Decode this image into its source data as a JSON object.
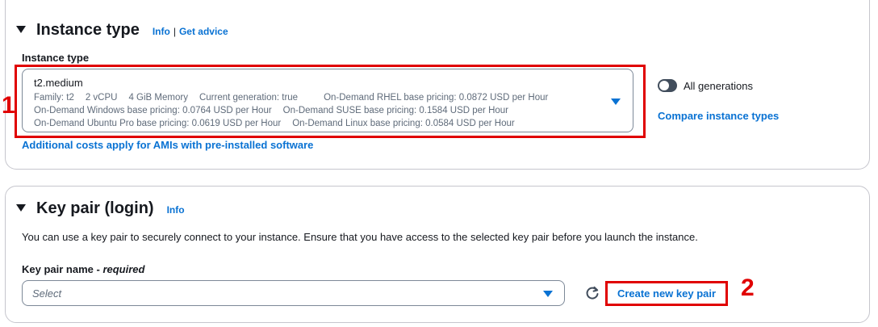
{
  "instance_section": {
    "title": "Instance type",
    "info_label": "Info",
    "separator": "|",
    "advice_label": "Get advice",
    "field_label": "Instance type",
    "selected": {
      "name": "t2.medium",
      "line1": [
        "Family: t2",
        "2 vCPU",
        "4 GiB Memory",
        "Current generation: true",
        "On-Demand RHEL base pricing: 0.0872 USD per Hour"
      ],
      "line2": [
        "On-Demand Windows base pricing: 0.0764 USD per Hour",
        "On-Demand SUSE base pricing: 0.1584 USD per Hour"
      ],
      "line3": [
        "On-Demand Ubuntu Pro base pricing: 0.0619 USD per Hour",
        "On-Demand Linux base pricing: 0.0584 USD per Hour"
      ]
    },
    "toggle_label": "All generations",
    "compare_link": "Compare instance types",
    "costs_link": "Additional costs apply for AMIs with pre-installed software",
    "marker": "1"
  },
  "keypair_section": {
    "title": "Key pair (login)",
    "info_label": "Info",
    "description": "You can use a key pair to securely connect to your instance. Ensure that you have access to the selected key pair before you launch the instance.",
    "field_label": "Key pair name - ",
    "field_required": "required",
    "select_placeholder": "Select",
    "create_button": "Create new key pair",
    "marker": "2"
  },
  "colors": {
    "link": "#0972d3",
    "highlight": "#e00000",
    "border": "#c6c6cd"
  }
}
